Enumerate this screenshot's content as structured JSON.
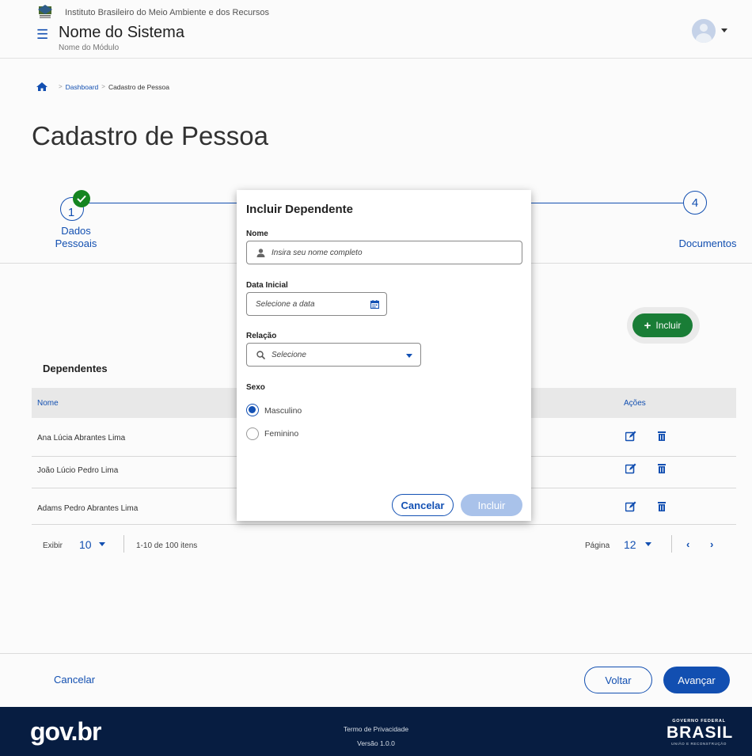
{
  "header": {
    "institution": "Instituto Brasileiro do Meio Ambiente e dos Recursos",
    "system_title": "Nome do Sistema",
    "module_name": "Nome do Módulo"
  },
  "breadcrumb": [
    "Dashboard",
    "Cadastro de Pessoa"
  ],
  "page_title": "Cadastro de Pessoa",
  "stepper": {
    "step1_number": "1",
    "step1_label": "Dados\nPessoais",
    "step4_number": "4",
    "step4_label": "Documentos"
  },
  "include_button": "Incluir",
  "table": {
    "title": "Dependentes",
    "columns": [
      "Nome",
      "Ações"
    ],
    "rows": [
      {
        "nome": "Ana Lúcia Abrantes Lima"
      },
      {
        "nome": "João Lúcio Pedro Lima"
      },
      {
        "nome": "Adams Pedro Abrantes Lima"
      }
    ]
  },
  "pagination": {
    "show_label": "Exibir",
    "page_size": "10",
    "range": "1-10 de 100 itens",
    "page_label": "Página",
    "page": "12"
  },
  "actions": {
    "cancel": "Cancelar",
    "back": "Voltar",
    "next": "Avançar"
  },
  "footer": {
    "logo": "gov.br",
    "privacy": "Termo de Privacidade",
    "version": "Versão 1.0.0",
    "brand_top": "GOVERNO FEDERAL",
    "brand_main": "BRASIL",
    "brand_bottom": "UNIÃO E RECONSTRUÇÃO"
  },
  "modal": {
    "title": "Incluir Dependente",
    "name_label": "Nome",
    "name_placeholder": "Insira seu nome completo",
    "date_label": "Data Inicial",
    "date_placeholder": "Selecione a data",
    "relation_label": "Relação",
    "relation_placeholder": "Selecione",
    "sex_label": "Sexo",
    "sex_options": [
      "Masculino",
      "Feminino"
    ],
    "sex_selected": "Masculino",
    "cancel": "Cancelar",
    "submit": "Incluir"
  },
  "colors": {
    "primary": "#1351b4",
    "success": "#168821",
    "footer_bg": "#071d41"
  }
}
